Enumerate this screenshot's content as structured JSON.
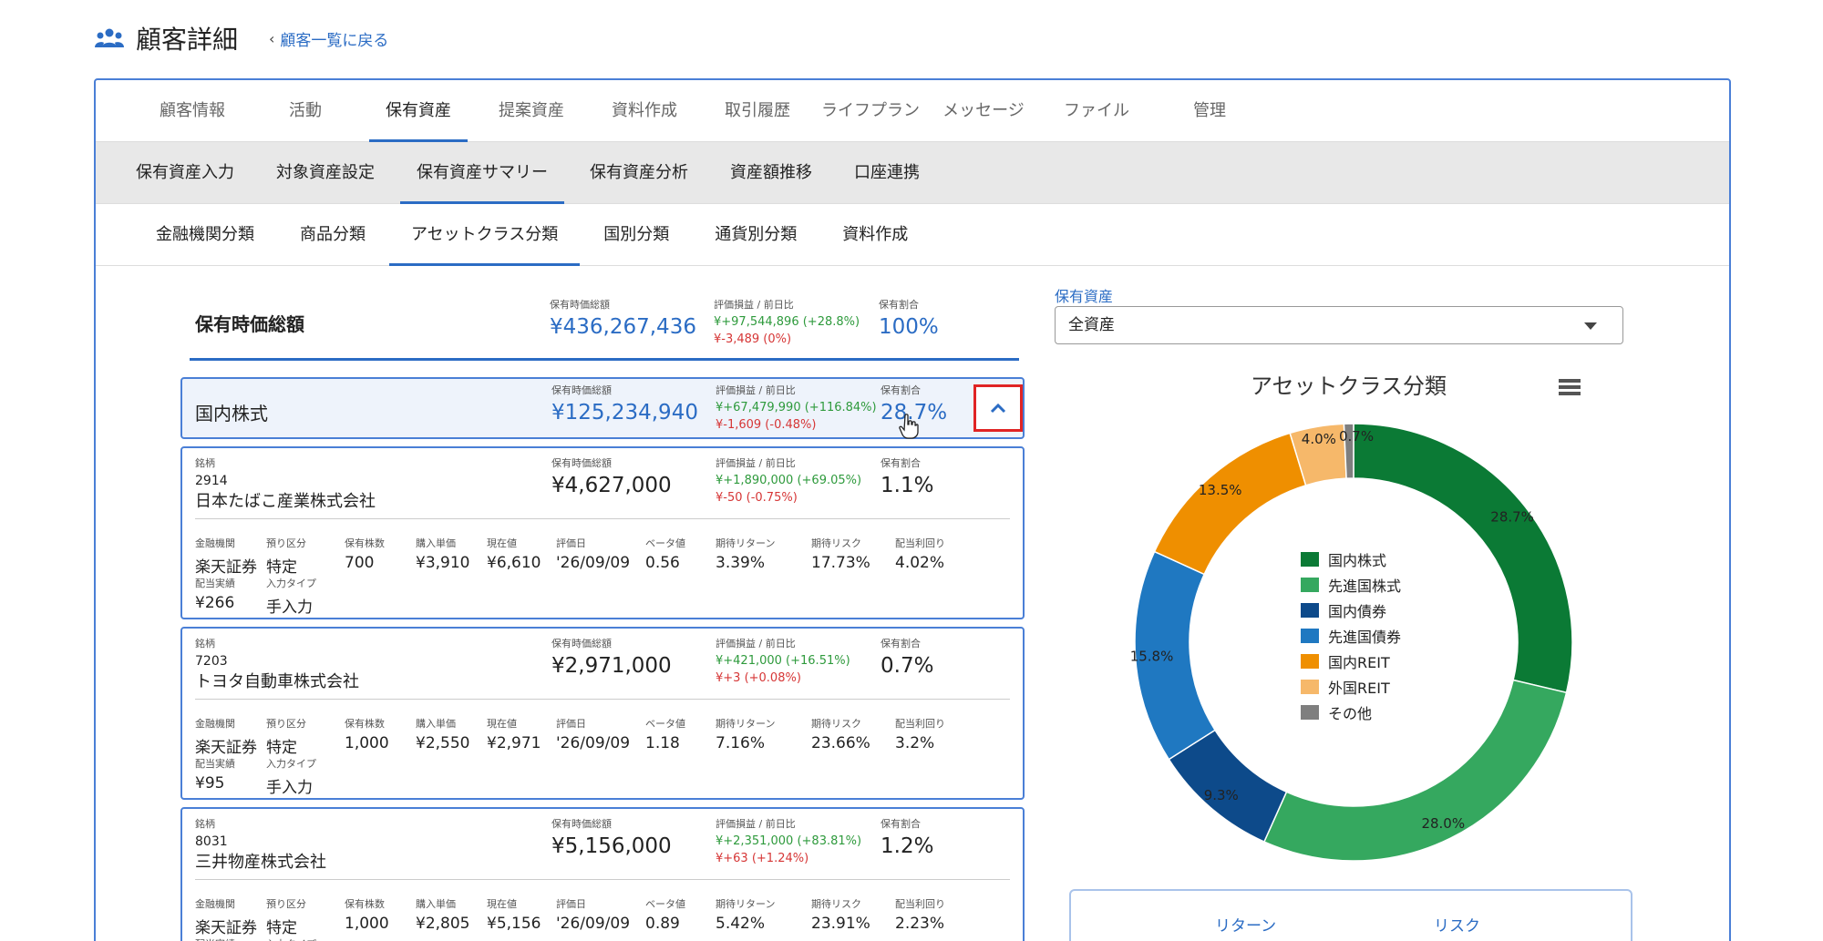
{
  "header": {
    "title": "顧客詳細",
    "back_label": "顧客一覧に戻る"
  },
  "tabs_main": [
    {
      "label": "顧客情報",
      "active": false
    },
    {
      "label": "活動",
      "active": false
    },
    {
      "label": "保有資産",
      "active": true
    },
    {
      "label": "提案資産",
      "active": false
    },
    {
      "label": "資料作成",
      "active": false
    },
    {
      "label": "取引履歴",
      "active": false
    },
    {
      "label": "ライフプラン",
      "active": false
    },
    {
      "label": "メッセージ",
      "active": false
    },
    {
      "label": "ファイル",
      "active": false
    },
    {
      "label": "管理",
      "active": false
    }
  ],
  "tabs_sub": [
    {
      "label": "保有資産入力",
      "active": false
    },
    {
      "label": "対象資産設定",
      "active": false
    },
    {
      "label": "保有資産サマリー",
      "active": true
    },
    {
      "label": "保有資産分析",
      "active": false
    },
    {
      "label": "資産額推移",
      "active": false
    },
    {
      "label": "口座連携",
      "active": false
    }
  ],
  "tabs_class": [
    {
      "label": "金融機関分類",
      "active": false
    },
    {
      "label": "商品分類",
      "active": false
    },
    {
      "label": "アセットクラス分類",
      "active": true
    },
    {
      "label": "国別分類",
      "active": false
    },
    {
      "label": "通貨別分類",
      "active": false
    },
    {
      "label": "資料作成",
      "active": false
    }
  ],
  "summary": {
    "name": "保有時価総額",
    "lbl_value": "保有時価総額",
    "value": "¥436,267,436",
    "lbl_pl": "評価損益 / 前日比",
    "pl": "¥+97,544,896 (+28.8%)",
    "day": "¥-3,489 (0%)",
    "lbl_ratio": "保有割合",
    "ratio": "100%"
  },
  "asset_row": {
    "name": "国内株式",
    "lbl_value": "保有時価総額",
    "value": "¥125,234,940",
    "lbl_pl": "評価損益 / 前日比",
    "pl": "¥+67,479,990 (+116.84%)",
    "day": "¥-1,609 (-0.48%)",
    "lbl_ratio": "保有割合",
    "ratio": "28.7%"
  },
  "stock_labels": {
    "brand": "銘柄",
    "value": "保有時価総額",
    "pl": "評価損益 / 前日比",
    "ratio": "保有割合",
    "inst": "金融機関",
    "acct": "預り区分",
    "qty": "保有株数",
    "buy": "購入単価",
    "cur": "現在値",
    "date": "評価日",
    "beta": "ベータ値",
    "ret": "期待リターン",
    "risk": "期待リスク",
    "yield": "配当利回り",
    "div": "配当実績",
    "input": "入力タイプ"
  },
  "stocks": [
    {
      "code": "2914",
      "name": "日本たばこ産業株式会社",
      "value": "¥4,627,000",
      "pl": "¥+1,890,000 (+69.05%)",
      "day": "¥-50 (-0.75%)",
      "ratio": "1.1%",
      "inst": "楽天証券",
      "acct": "特定",
      "qty": "700",
      "buy": "¥3,910",
      "cur": "¥6,610",
      "date": "'26/09/09",
      "beta": "0.56",
      "ret": "3.39%",
      "risk": "17.73%",
      "yield": "4.02%",
      "div": "¥266",
      "input": "手入力"
    },
    {
      "code": "7203",
      "name": "トヨタ自動車株式会社",
      "value": "¥2,971,000",
      "pl": "¥+421,000 (+16.51%)",
      "day": "¥+3 (+0.08%)",
      "ratio": "0.7%",
      "inst": "楽天証券",
      "acct": "特定",
      "qty": "1,000",
      "buy": "¥2,550",
      "cur": "¥2,971",
      "date": "'26/09/09",
      "beta": "1.18",
      "ret": "7.16%",
      "risk": "23.66%",
      "yield": "3.2%",
      "div": "¥95",
      "input": "手入力"
    },
    {
      "code": "8031",
      "name": "三井物産株式会社",
      "value": "¥5,156,000",
      "pl": "¥+2,351,000 (+83.81%)",
      "day": "¥+63 (+1.24%)",
      "ratio": "1.2%",
      "inst": "楽天証券",
      "acct": "特定",
      "qty": "1,000",
      "buy": "¥2,805",
      "cur": "¥5,156",
      "date": "'26/09/09",
      "beta": "0.89",
      "ret": "5.42%",
      "risk": "23.91%",
      "yield": "2.23%",
      "div": "",
      "input": ""
    }
  ],
  "right": {
    "select_label": "保有資産",
    "select_value": "全資産",
    "tab_return": "リターン",
    "tab_risk": "リスク"
  },
  "chart_data": {
    "type": "pie",
    "title": "アセットクラス分類",
    "donut": true,
    "legend_position": "center",
    "categories": [
      "国内株式",
      "先進国株式",
      "国内債券",
      "先進国債券",
      "国内REIT",
      "外国REIT",
      "その他"
    ],
    "values": [
      28.7,
      28.0,
      9.3,
      15.8,
      13.5,
      4.0,
      0.7
    ],
    "labels": [
      "28.7%",
      "28.0%",
      "9.3%",
      "15.8%",
      "13.5%",
      "4.0%",
      "0.7%"
    ],
    "colors": [
      "#0b7a35",
      "#35a85f",
      "#0d4a8a",
      "#1f78c1",
      "#ef8f00",
      "#f6b86a",
      "#7f7f7f"
    ]
  }
}
